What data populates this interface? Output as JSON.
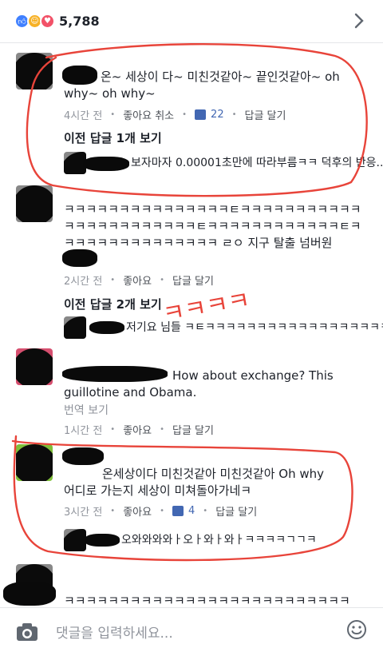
{
  "reactions": {
    "count": "5,788",
    "icons": [
      "like-icon",
      "haha-icon",
      "love-icon"
    ]
  },
  "comments": [
    {
      "text_lines": [
        "온~ 세상이 다~ 미친것같아~ 끝인것같아~ oh",
        "why~ oh why~"
      ],
      "time": "4시간 전",
      "like_action": "좋아요 취소",
      "likes": "22",
      "reply_action": "답글 달기",
      "replies_label": "이전 답글 1개 보기",
      "reply_preview": "보자마자 0.00001초만에 따라부름ㅋㅋ 덕후의 반응..."
    },
    {
      "text_lines": [
        "ㅋㅋㅋㅋㅋㅋㅋㅋㅋㅋㅋㅋㅋㅋㅋㅌㅋㅋㅋㅋㅋㅋㅋㅋㅋㅋㅋ",
        "ㅋㅋㅋㅋㅋㅋㅋㅋㅋㅋㅋㅋㅌㅋㅋㅋㅋㅋㅋㅋㅋㅋㅋㅋㅋㅌㅋ",
        "ㅋㅋㅋㅋㅋㅋㅋㅋㅋㅋㅋㅋㅋㅋ ㄹㅇ 지구 탈출 넘버원"
      ],
      "time": "2시간 전",
      "like_action": "좋아요",
      "reply_action": "답글 달기",
      "replies_label": "이전 답글 2개 보기",
      "reply_preview": "저기요 님들 ㅋㅌㅋㅋㅋㅋㅋㅋㅋㅋㅋㅋㅋㅋㅋㅋㅋㅋㅋㅋ..."
    },
    {
      "text_lines": [
        "How about exchange? This",
        "guillotine and Obama."
      ],
      "translate": "번역 보기",
      "time": "1시간 전",
      "like_action": "좋아요",
      "reply_action": "답글 달기"
    },
    {
      "text_lines": [
        "온세상이다 미친것같아 미친것같아 Oh why",
        "어디로 가는지 세상이 미쳐돌아가네ㅋ"
      ],
      "time": "3시간 전",
      "like_action": "좋아요",
      "likes": "4",
      "reply_action": "답글 달기",
      "reply_preview": "오와와와와ㅏ오ㅏ와ㅏ와ㅏㅋㅋㅋㅋㄱㄱㅋ"
    },
    {
      "text_lines": [
        "ㅋㅋㅋㅋㅋㅋㅋㅋㅋㅋㅋㅋㅋㅋㅋㅋㅋㅋㅋㅋㅋㅋㅋㅋㅋㅋ"
      ]
    }
  ],
  "annotation_text": "ㅋㅋㅋㅋ",
  "composer": {
    "placeholder": "댓글을 입력하세요..."
  },
  "colors": {
    "accent": "#4267b2",
    "annotation": "#e8443a",
    "muted": "#90949c"
  }
}
